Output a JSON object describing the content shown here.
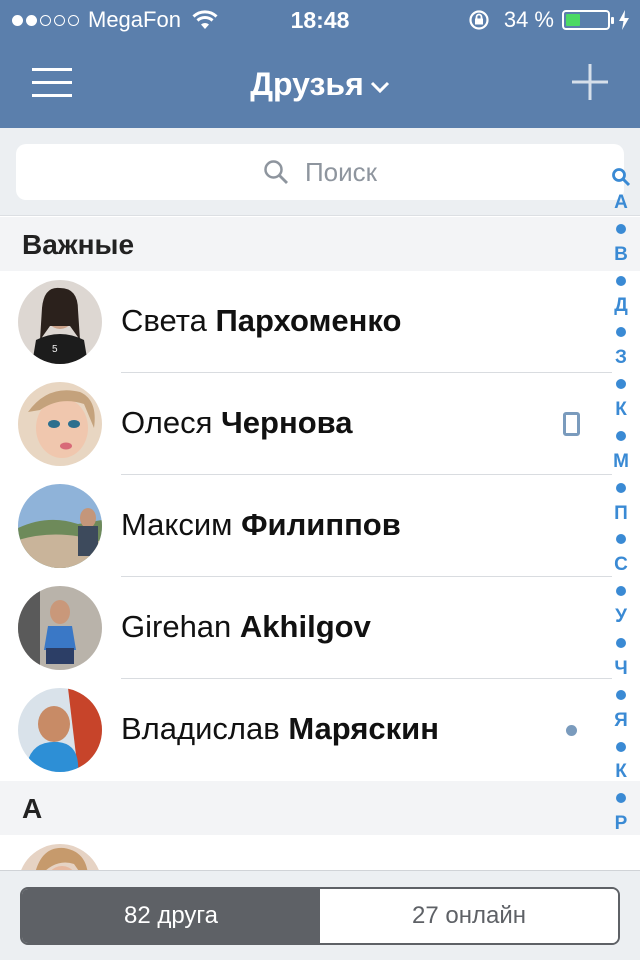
{
  "status": {
    "carrier": "MegaFon",
    "time": "18:48",
    "battery_text": "34 %",
    "battery_level": 0.34,
    "signal_bars_filled": 2,
    "signal_bars_total": 5
  },
  "nav": {
    "title": "Друзья",
    "menu_icon": "hamburger-icon",
    "add_icon": "plus-icon",
    "dropdown_icon": "chevron-down-icon"
  },
  "search": {
    "placeholder": "Поиск"
  },
  "sections": [
    {
      "header": "Важные",
      "friends": [
        {
          "first": "Света",
          "last": "Пархоменко",
          "status": ""
        },
        {
          "first": "Олеся",
          "last": "Чернова",
          "status": "mobile"
        },
        {
          "first": "Максим",
          "last": "Филиппов",
          "status": ""
        },
        {
          "first": "Girehan",
          "last": "Akhilgov",
          "status": ""
        },
        {
          "first": "Владислав",
          "last": "Маряскин",
          "status": "online"
        }
      ]
    },
    {
      "header": "А",
      "friends": []
    }
  ],
  "index": [
    "search",
    "А",
    "•",
    "В",
    "•",
    "Д",
    "•",
    "З",
    "•",
    "К",
    "•",
    "М",
    "•",
    "П",
    "•",
    "С",
    "•",
    "У",
    "•",
    "Ч",
    "•",
    "Я",
    "•",
    "К",
    "•",
    "Р"
  ],
  "tabs": {
    "friends_count_label": "82 друга",
    "online_count_label": "27 онлайн",
    "active": "friends"
  },
  "colors": {
    "nav_bg": "#5b7fac",
    "index_blue": "#3a8ad4",
    "status_icon": "#7a9bbd",
    "battery_green": "#4cd964"
  }
}
